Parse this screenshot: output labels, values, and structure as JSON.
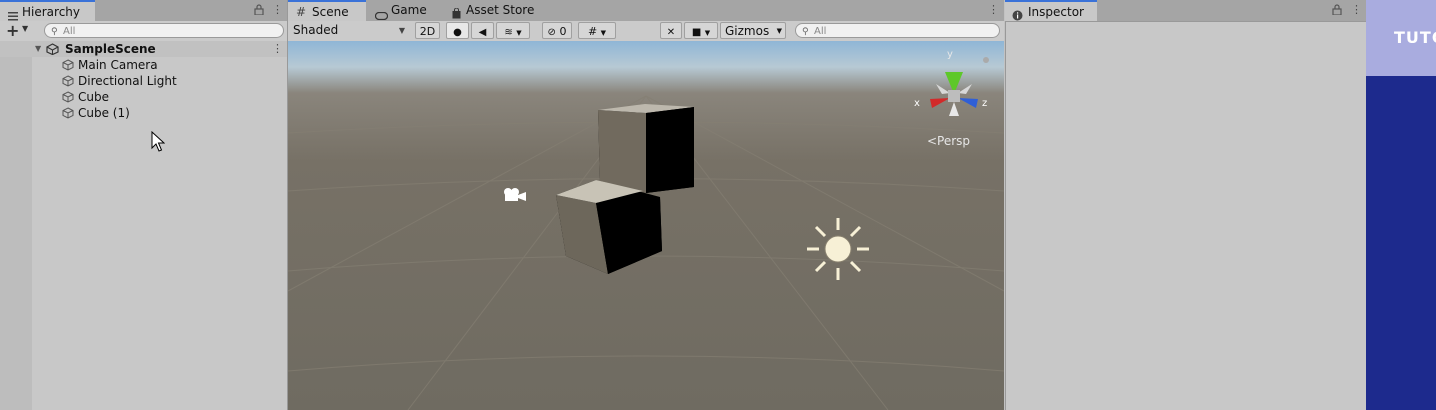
{
  "hierarchy": {
    "tab_label": "Hierarchy",
    "add_label": "+",
    "search_placeholder": "All",
    "scene_name": "SampleScene",
    "items": [
      {
        "label": "Main Camera"
      },
      {
        "label": "Directional Light"
      },
      {
        "label": "Cube"
      },
      {
        "label": "Cube (1)"
      }
    ]
  },
  "scene": {
    "tabs": [
      {
        "label": "Scene",
        "icon": "grid-icon"
      },
      {
        "label": "Game",
        "icon": "gamepad-icon"
      },
      {
        "label": "Asset Store",
        "icon": "bag-icon"
      }
    ],
    "toolbar": {
      "shading_mode": "Shaded",
      "mode_2d": "2D",
      "hidden_count": "0",
      "gizmos_label": "Gizmos",
      "search_placeholder": "All"
    },
    "gizmo": {
      "x_label": "x",
      "y_label": "y",
      "z_label": "z",
      "view_label": "<Persp"
    }
  },
  "inspector": {
    "tab_label": "Inspector"
  },
  "side_banner": {
    "text": "TUTO"
  },
  "colors": {
    "accent": "#3a72d8",
    "banner": "#1d2a8d",
    "axis_x": "#d22a2a",
    "axis_y": "#5ec82a",
    "axis_z": "#2f5fd6"
  }
}
